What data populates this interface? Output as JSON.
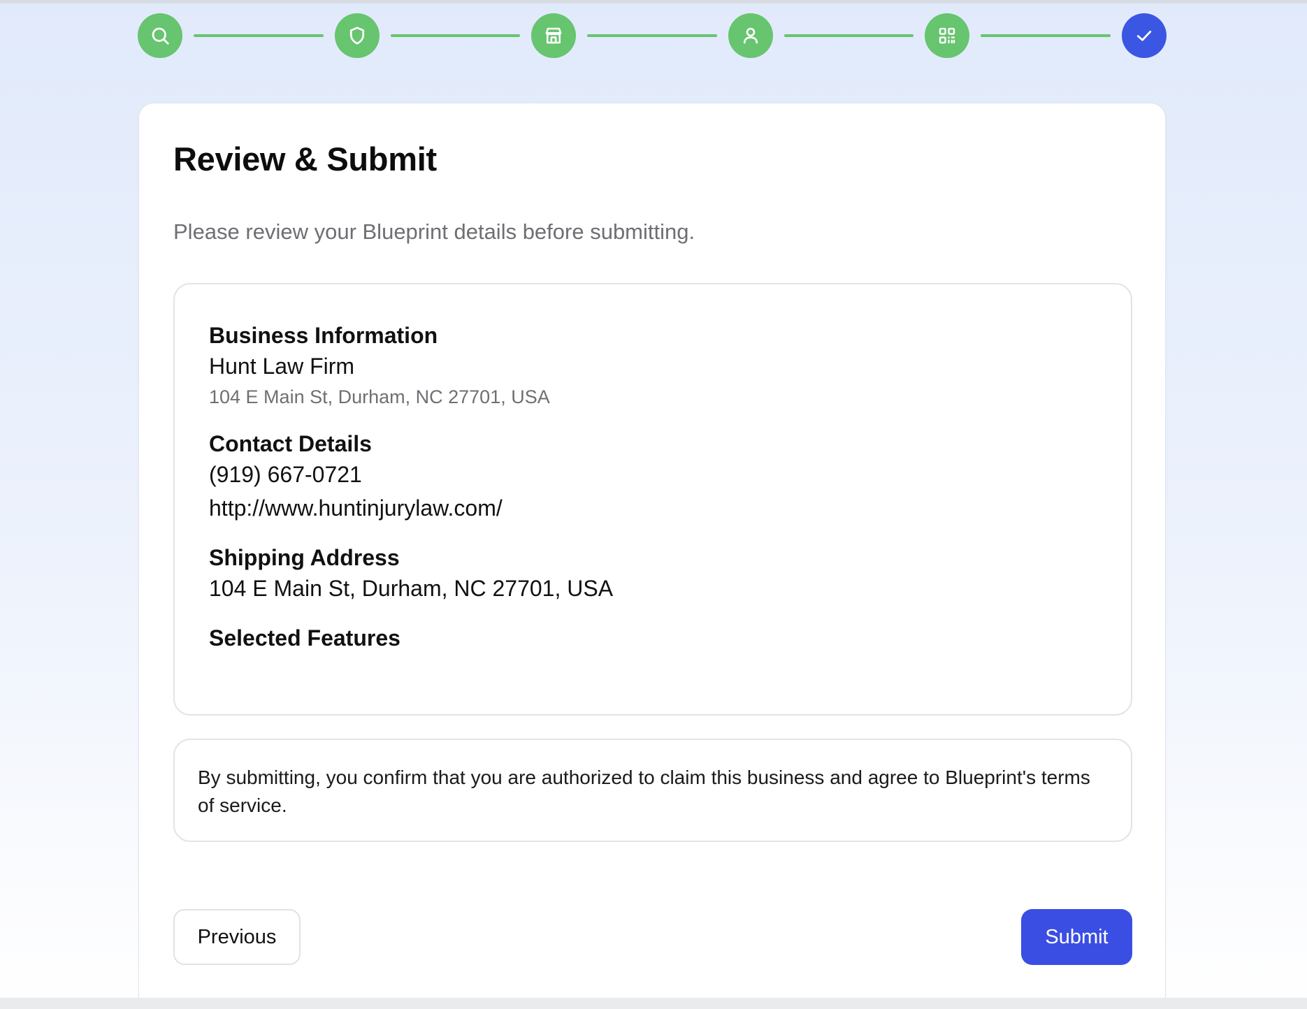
{
  "colors": {
    "step_complete": "#67c46f",
    "step_current": "#3b56e2",
    "step_line": "#67c46f",
    "submit_button": "#3b4ee3"
  },
  "stepper": {
    "steps": [
      {
        "icon": "search-icon",
        "state": "complete"
      },
      {
        "icon": "shield-icon",
        "state": "complete"
      },
      {
        "icon": "store-icon",
        "state": "complete"
      },
      {
        "icon": "user-icon",
        "state": "complete"
      },
      {
        "icon": "qr-code-icon",
        "state": "complete"
      },
      {
        "icon": "check-icon",
        "state": "current"
      }
    ]
  },
  "page": {
    "title": "Review & Submit",
    "subtitle": "Please review your Blueprint details before submitting."
  },
  "summary": {
    "business": {
      "heading": "Business Information",
      "name": "Hunt Law Firm",
      "address": "104 E Main St, Durham, NC 27701, USA"
    },
    "contact": {
      "heading": "Contact Details",
      "phone": "(919) 667-0721",
      "website": "http://www.huntinjurylaw.com/"
    },
    "shipping": {
      "heading": "Shipping Address",
      "address": "104 E Main St, Durham, NC 27701, USA"
    },
    "features": {
      "heading": "Selected Features"
    }
  },
  "terms": {
    "text": "By submitting, you confirm that you are authorized to claim this business and agree to Blueprint's terms of service."
  },
  "actions": {
    "previous_label": "Previous",
    "submit_label": "Submit"
  }
}
